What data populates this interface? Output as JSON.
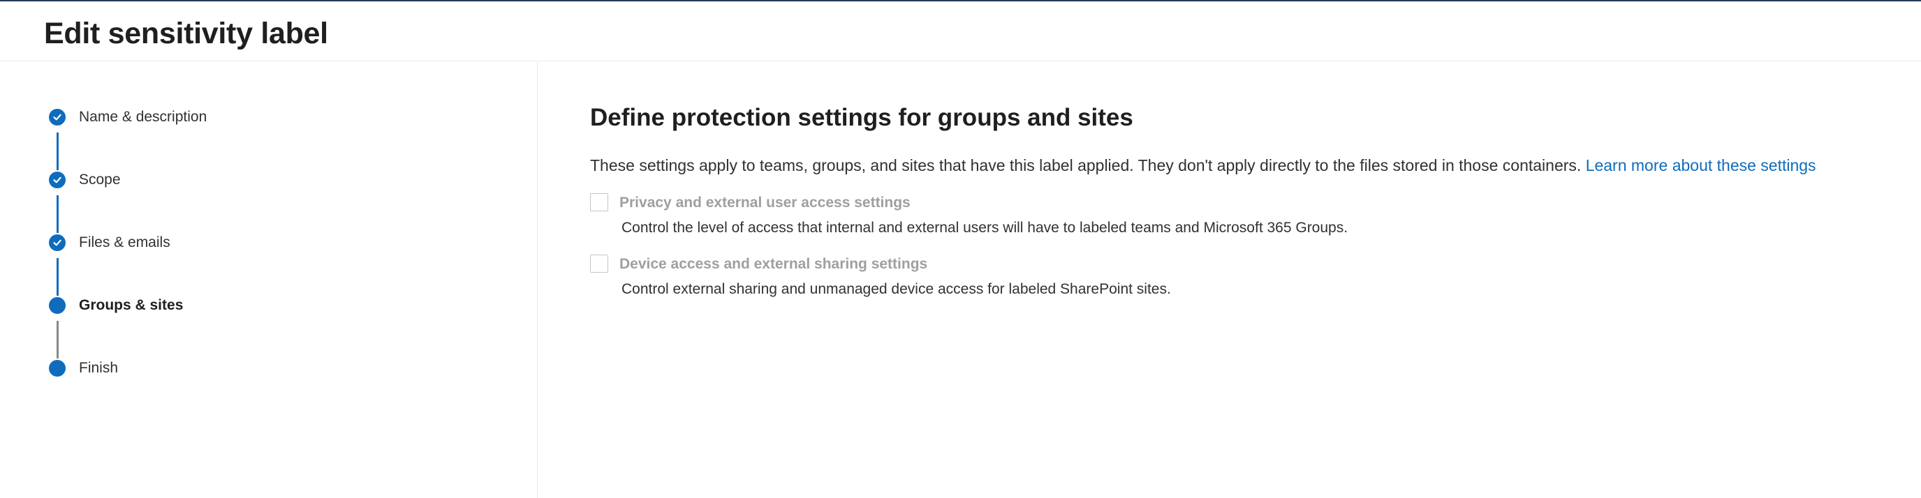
{
  "header": {
    "title": "Edit sensitivity label"
  },
  "steps": [
    {
      "label": "Name & description",
      "state": "completed"
    },
    {
      "label": "Scope",
      "state": "completed"
    },
    {
      "label": "Files & emails",
      "state": "completed"
    },
    {
      "label": "Groups & sites",
      "state": "current"
    },
    {
      "label": "Finish",
      "state": "pending"
    }
  ],
  "main": {
    "title": "Define protection settings for groups and sites",
    "intro": "These settings apply to teams, groups, and sites that have this label applied. They don't apply directly to the files stored in those containers.",
    "learn_more": "Learn more about these settings",
    "options": [
      {
        "label": "Privacy and external user access settings",
        "description": "Control the level of access that internal and external users will have to labeled teams and Microsoft 365 Groups.",
        "checked": false,
        "disabled": true
      },
      {
        "label": "Device access and external sharing settings",
        "description": "Control external sharing and unmanaged device access for labeled SharePoint sites.",
        "checked": false,
        "disabled": true
      }
    ]
  },
  "colors": {
    "accent": "#0f6cbd",
    "connector_pending": "#8a8886",
    "disabled_text": "#a19f9d",
    "top_rule": "#243a5e"
  }
}
